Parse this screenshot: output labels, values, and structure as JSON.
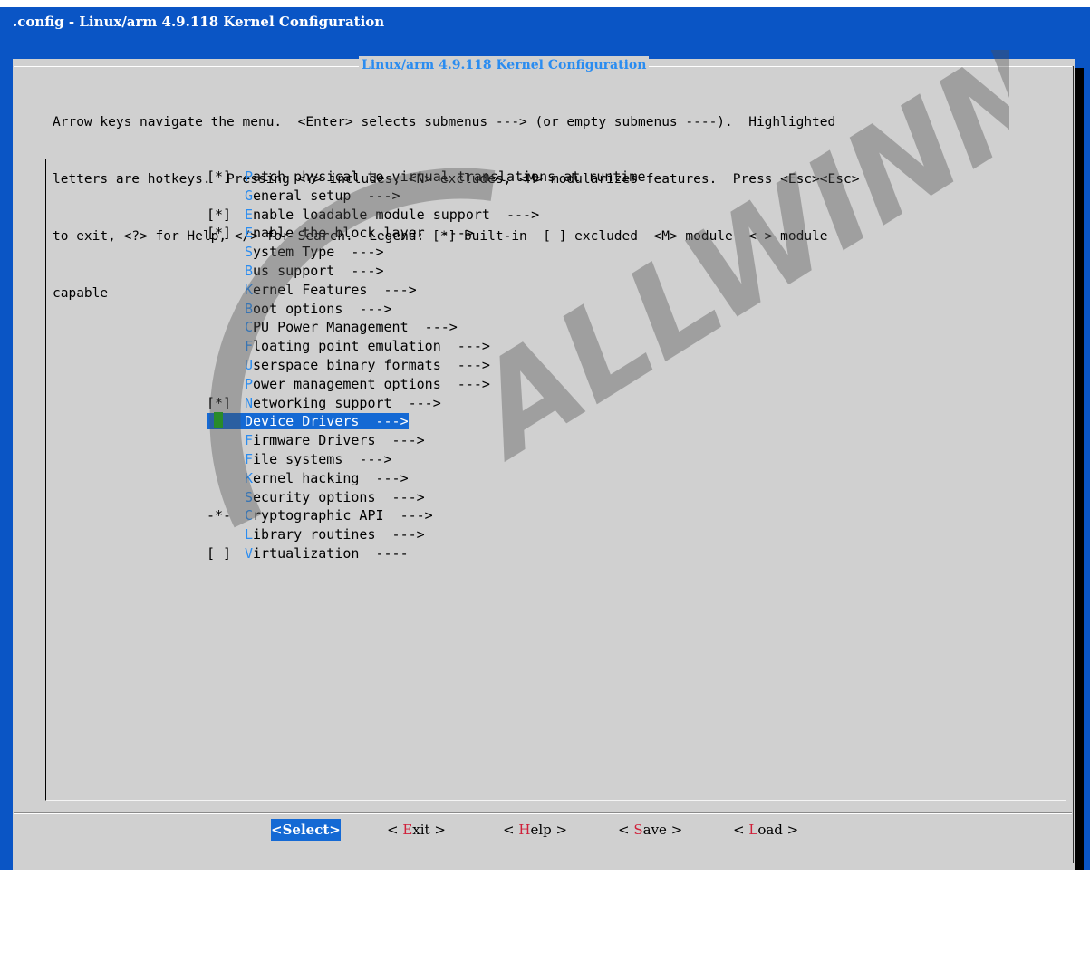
{
  "window": {
    "title": ".config - Linux/arm 4.9.118 Kernel Configuration"
  },
  "dialog": {
    "title": "Linux/arm 4.9.118 Kernel Configuration",
    "help_lines": [
      "Arrow keys navigate the menu.  <Enter> selects submenus ---> (or empty submenus ----).  Highlighted",
      "letters are hotkeys.  Pressing <Y> includes, <N> excludes, <M> modularizes features.  Press <Esc><Esc>",
      "to exit, <?> for Help, </> for Search.  Legend: [*] built-in  [ ] excluded  <M> module  < > module",
      "capable"
    ]
  },
  "menu": {
    "items": [
      {
        "prefix": "[*]",
        "hotkey": "P",
        "rest": "atch physical to virtual translations at runtime",
        "selected": false
      },
      {
        "prefix": "",
        "hotkey": "G",
        "rest": "eneral setup  --->",
        "selected": false
      },
      {
        "prefix": "[*]",
        "hotkey": "E",
        "rest": "nable loadable module support  --->",
        "selected": false
      },
      {
        "prefix": "[*]",
        "hotkey": "E",
        "rest": "nable the block layer  --->",
        "selected": false
      },
      {
        "prefix": "",
        "hotkey": "S",
        "rest": "ystem Type  --->",
        "selected": false
      },
      {
        "prefix": "",
        "hotkey": "B",
        "rest": "us support  --->",
        "selected": false
      },
      {
        "prefix": "",
        "hotkey": "K",
        "rest": "ernel Features  --->",
        "selected": false
      },
      {
        "prefix": "",
        "hotkey": "B",
        "rest": "oot options  --->",
        "selected": false
      },
      {
        "prefix": "",
        "hotkey": "C",
        "rest": "PU Power Management  --->",
        "selected": false
      },
      {
        "prefix": "",
        "hotkey": "F",
        "rest": "loating point emulation  --->",
        "selected": false
      },
      {
        "prefix": "",
        "hotkey": "U",
        "rest": "serspace binary formats  --->",
        "selected": false
      },
      {
        "prefix": "",
        "hotkey": "P",
        "rest": "ower management options  --->",
        "selected": false
      },
      {
        "prefix": "[*]",
        "hotkey": "N",
        "rest": "etworking support  --->",
        "pre_hotkey": "",
        "selected": false
      },
      {
        "prefix": "",
        "hotkey": "",
        "rest": "Device Drivers  --->",
        "selected": true
      },
      {
        "prefix": "",
        "hotkey": "F",
        "rest": "irmware Drivers  --->",
        "selected": false
      },
      {
        "prefix": "",
        "hotkey": "F",
        "rest": "ile systems  --->",
        "selected": false
      },
      {
        "prefix": "",
        "hotkey": "K",
        "rest": "ernel hacking  --->",
        "selected": false
      },
      {
        "prefix": "",
        "hotkey": "S",
        "rest": "ecurity options  --->",
        "selected": false
      },
      {
        "prefix": "-*-",
        "hotkey": "C",
        "rest": "ryptographic API  --->",
        "selected": false
      },
      {
        "prefix": "",
        "hotkey": "L",
        "rest": "ibrary routines  --->",
        "selected": false
      },
      {
        "prefix": "[ ]",
        "hotkey": "V",
        "rest": "irtualization  ----",
        "selected": false
      }
    ]
  },
  "buttons": {
    "select": {
      "open": "<",
      "hotkey": "S",
      "rest": "elect",
      "close": ">"
    },
    "exit": {
      "open": "< ",
      "hotkey": "E",
      "rest": "xit",
      "close": " >"
    },
    "help": {
      "open": "< ",
      "hotkey": "H",
      "rest": "elp",
      "close": " >"
    },
    "save": {
      "open": "< ",
      "hotkey": "S",
      "rest": "ave",
      "close": " >"
    },
    "load": {
      "open": "< ",
      "hotkey": "L",
      "rest": "oad",
      "close": " >"
    }
  },
  "watermark": {
    "text": "ALLWINNER"
  },
  "colors": {
    "background_blue": "#0a55c5",
    "dialog_gray": "#d0d0d0",
    "hotkey_blue": "#2a8cf0",
    "selection_blue": "#1469d4",
    "cursor_green": "#12b012",
    "button_hotkey_red": "#d0203a"
  }
}
